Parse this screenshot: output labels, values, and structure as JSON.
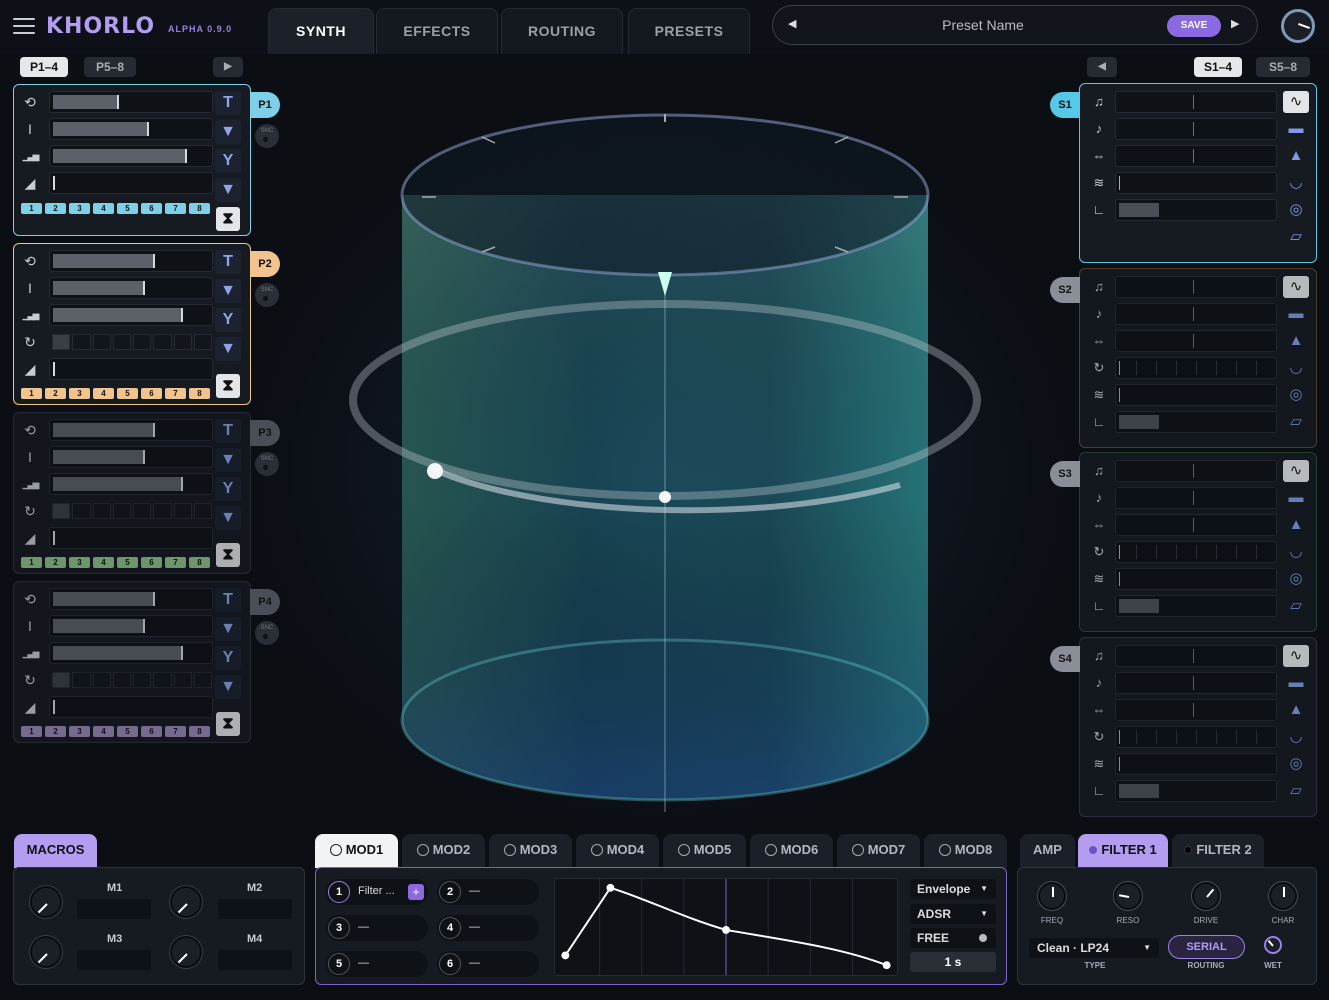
{
  "header": {
    "logo": "KHORLO",
    "version": "ALPHA 0.9.0",
    "tabs": [
      "SYNTH",
      "EFFECTS",
      "ROUTING",
      "PRESETS"
    ],
    "active_tab": "SYNTH",
    "preset_name": "Preset Name",
    "save_label": "SAVE",
    "prev_arrow": "◀",
    "next_arrow": "▶"
  },
  "left_pages": {
    "page1": "P1–4",
    "page2": "P5–8",
    "arrow": "▶"
  },
  "right_pages": {
    "arrow": "◀",
    "page1": "S1–4",
    "page2": "S5–8"
  },
  "p_panels": [
    {
      "tag": "P1",
      "color": "#7ed0e8",
      "snc": "SNC",
      "steps": [
        "1",
        "2",
        "3",
        "4",
        "5",
        "6",
        "7",
        "8"
      ]
    },
    {
      "tag": "P2",
      "color": "#f0c48c",
      "snc": "SNC",
      "steps": [
        "1",
        "2",
        "3",
        "4",
        "5",
        "6",
        "7",
        "8"
      ]
    },
    {
      "tag": "P3",
      "color": "#8fc48a",
      "snc": "SNC",
      "steps": [
        "1",
        "2",
        "3",
        "4",
        "5",
        "6",
        "7",
        "8"
      ]
    },
    {
      "tag": "P4",
      "color": "#9a8ab8",
      "snc": "SNC",
      "steps": [
        "1",
        "2",
        "3",
        "4",
        "5",
        "6",
        "7",
        "8"
      ]
    }
  ],
  "s_panels": [
    {
      "tag": "S1",
      "color": "#56c8e8"
    },
    {
      "tag": "S2",
      "color": "#8a8f97"
    },
    {
      "tag": "S3",
      "color": "#8a8f97"
    },
    {
      "tag": "S4",
      "color": "#8a8f97"
    }
  ],
  "icons": {
    "left_rows": [
      "loop-icon",
      "cursor-icon",
      "bars-icon",
      "ramp-icon",
      "rotate-icon"
    ],
    "right_rows": [
      "note-icon",
      "note-dot-icon",
      "spread-icon",
      "rotate-icon",
      "wave-icon",
      "angle-icon"
    ],
    "right_shapes": [
      "sine-shape-icon",
      "flat-shape-icon",
      "bell-shape-icon",
      "bowl-shape-icon",
      "circle-shape-icon",
      "slope-shape-icon"
    ]
  },
  "macros": {
    "tab": "MACROS",
    "items": [
      {
        "label": "M1"
      },
      {
        "label": "M2"
      },
      {
        "label": "M3"
      },
      {
        "label": "M4"
      }
    ]
  },
  "mod": {
    "tabs": [
      "MOD1",
      "MOD2",
      "MOD3",
      "MOD4",
      "MOD5",
      "MOD6",
      "MOD7",
      "MOD8"
    ],
    "active": "MOD1",
    "slots": [
      {
        "n": "1",
        "v": "Filter ..."
      },
      {
        "n": "2",
        "v": "—"
      },
      {
        "n": "3",
        "v": "—"
      },
      {
        "n": "4",
        "v": "—"
      },
      {
        "n": "5",
        "v": "—"
      },
      {
        "n": "6",
        "v": "—"
      }
    ],
    "add_label": "+",
    "type": "Envelope",
    "mode": "ADSR",
    "sync": "FREE",
    "time": "1 s"
  },
  "filter": {
    "tabs": [
      "AMP",
      "FILTER 1",
      "FILTER 2"
    ],
    "active": "FILTER 1",
    "knobs": [
      "FREQ",
      "RESO",
      "DRIVE",
      "CHAR"
    ],
    "type_value": "Clean · LP24",
    "type_label": "TYPE",
    "routing_value": "SERIAL",
    "routing_label": "ROUTING",
    "wet_label": "WET"
  },
  "colors": {
    "accent": "#8a6ae0",
    "cyan": "#56c8e8"
  }
}
